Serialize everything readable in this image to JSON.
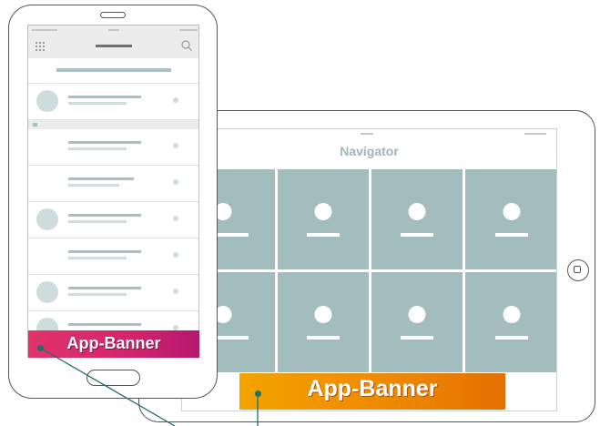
{
  "tablet": {
    "nav_title": "Navigator",
    "banner_label": "App-Banner",
    "tile_color": "#a3bcbd",
    "banner_colors": [
      "#f3a300",
      "#e37000"
    ]
  },
  "phone": {
    "banner_label": "App-Banner",
    "menu_icon": "grid-icon",
    "search_icon": "search-icon",
    "banner_colors": [
      "#e0336b",
      "#b4186f"
    ]
  },
  "connector_color": "#1f6f6a"
}
